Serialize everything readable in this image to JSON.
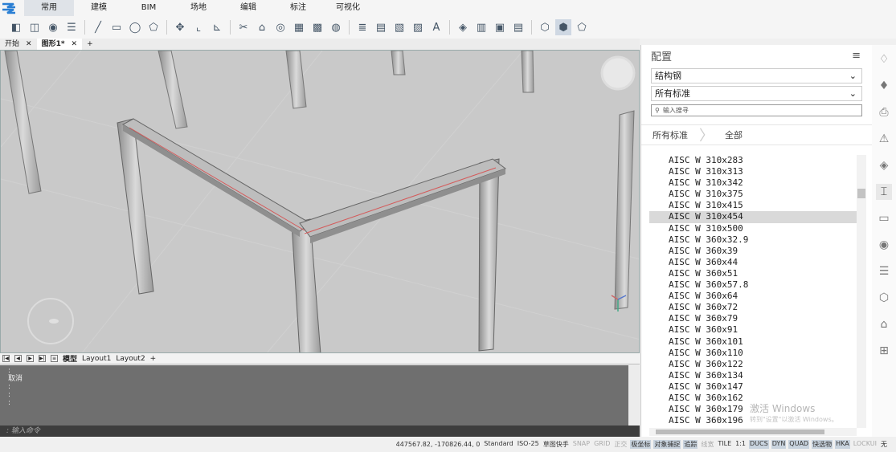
{
  "ribbon": {
    "tabs": [
      "常用",
      "建模",
      "BIM",
      "场地",
      "编辑",
      "标注",
      "可视化"
    ],
    "active_index": 0
  },
  "doc_tabs": [
    {
      "label": "开始",
      "close": "✕"
    },
    {
      "label": "图形1*",
      "close": "✕"
    }
  ],
  "doc_add": "+",
  "layout_tabs": {
    "model": "模型",
    "layout1": "Layout1",
    "layout2": "Layout2",
    "add": "+"
  },
  "command": {
    "lines": [
      ":",
      "取消",
      ":",
      ":",
      ":"
    ],
    "input_placeholder": "输入命令"
  },
  "panel": {
    "title": "配置",
    "menu_icon": "≡",
    "category": "结构钢",
    "standard": "所有标准",
    "search_placeholder": "输入搜寻",
    "breadcrumb": [
      "所有标准",
      "全部"
    ],
    "items": [
      "AISC W 310x283",
      "AISC W 310x313",
      "AISC W 310x342",
      "AISC W 310x375",
      "AISC W 310x415",
      "AISC W 310x454",
      "AISC W 310x500",
      "AISC W 360x32.9",
      "AISC W 360x39",
      "AISC W 360x44",
      "AISC W 360x51",
      "AISC W 360x57.8",
      "AISC W 360x64",
      "AISC W 360x72",
      "AISC W 360x79",
      "AISC W 360x91",
      "AISC W 360x101",
      "AISC W 360x110",
      "AISC W 360x122",
      "AISC W 360x134",
      "AISC W 360x147",
      "AISC W 360x162",
      "AISC W 360x179",
      "AISC W 360x196"
    ],
    "selected_index": 5,
    "watermark": "激活 Windows",
    "watermark_sub": "转到\"设置\"以激活 Windows。"
  },
  "status": {
    "coords": "447567.82, -170826.44, 0",
    "items": [
      {
        "t": "Standard",
        "s": "n"
      },
      {
        "t": "ISO-25",
        "s": "n"
      },
      {
        "t": "草图快手",
        "s": "n"
      },
      {
        "t": "SNAP",
        "s": "off"
      },
      {
        "t": "GRID",
        "s": "off"
      },
      {
        "t": "正交",
        "s": "off"
      },
      {
        "t": "极坐标",
        "s": "on"
      },
      {
        "t": "对象捕捉",
        "s": "on"
      },
      {
        "t": "追踪",
        "s": "on"
      },
      {
        "t": "线宽",
        "s": "off"
      },
      {
        "t": "TILE",
        "s": "n"
      },
      {
        "t": "1:1",
        "s": "n"
      },
      {
        "t": "DUCS",
        "s": "on"
      },
      {
        "t": "DYN",
        "s": "on"
      },
      {
        "t": "QUAD",
        "s": "on"
      },
      {
        "t": "快选物",
        "s": "on"
      },
      {
        "t": "HKA",
        "s": "on"
      },
      {
        "t": "LOCKUI",
        "s": "off"
      },
      {
        "t": "无",
        "s": "n"
      }
    ]
  }
}
